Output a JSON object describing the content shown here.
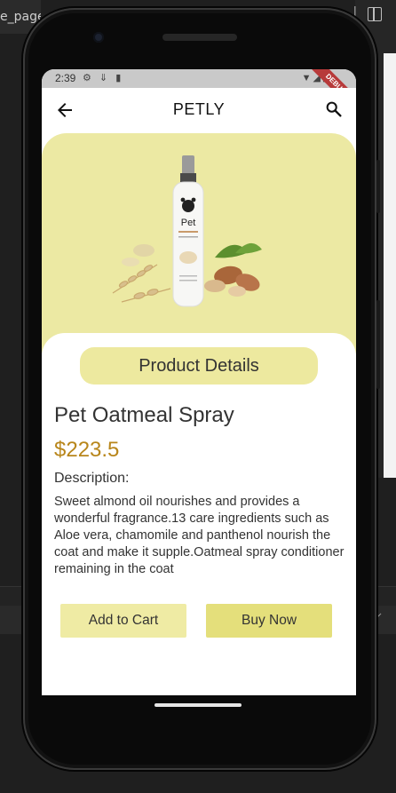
{
  "ide": {
    "tab_text": "e_page"
  },
  "status_bar": {
    "time": "2:39",
    "debug_label": "DEBUG"
  },
  "app_bar": {
    "title": "PETLY",
    "back_icon": "arrow-back-icon",
    "search_icon": "search-icon"
  },
  "product": {
    "image_icon": "oatmeal-spray-bottle-image",
    "bottle_label": "Pet",
    "section_title": "Product Details",
    "name": "Pet Oatmeal Spray",
    "price": "$223.5",
    "description_label": "Description:",
    "description": "Sweet almond oil nourishes and provides a wonderful fragrance.13 care ingredients such as Aloe vera, chamomile and panthenol nourish the coat and make it supple.Oatmeal spray conditioner remaining in the coat"
  },
  "actions": {
    "add_to_cart": "Add to Cart",
    "buy_now": "Buy Now"
  },
  "colors": {
    "hero_bg": "#ece9a3",
    "price": "#b8861b",
    "cart_btn": "#efeba4",
    "buy_btn": "#e4df7b"
  }
}
